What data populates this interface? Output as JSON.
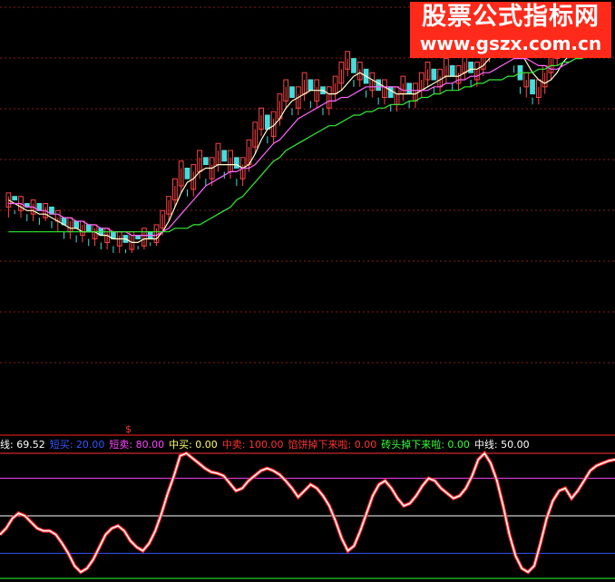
{
  "watermark": {
    "line1": "股票公式指标网",
    "line2": "www.gszx.com.cn"
  },
  "indicator_legend": [
    {
      "label": "线: 69.52",
      "color": "#ffffff"
    },
    {
      "label": "短买: 20.00",
      "color": "#3355ff"
    },
    {
      "label": "短卖: 80.00",
      "color": "#ff44ff"
    },
    {
      "label": "中买: 0.00",
      "color": "#ffff66"
    },
    {
      "label": "中卖: 100.00",
      "color": "#ff3333"
    },
    {
      "label": "馅饼掉下来啦: 0.00",
      "color": "#ff3333"
    },
    {
      "label": "砖头掉下来啦: 0.00",
      "color": "#33ff33"
    },
    {
      "label": "中线: 50.00",
      "color": "#ffffff"
    }
  ],
  "chart_data": [
    {
      "type": "candlestick",
      "panel": "price",
      "title": "",
      "grid": true,
      "ylim": [
        0,
        100
      ],
      "candles": [
        [
          0,
          44,
          48,
          41,
          47
        ],
        [
          1,
          47,
          46,
          42,
          43
        ],
        [
          2,
          43,
          47,
          41,
          45
        ],
        [
          3,
          45,
          44,
          40,
          42
        ],
        [
          4,
          42,
          46,
          40,
          45
        ],
        [
          5,
          45,
          43,
          39,
          41
        ],
        [
          6,
          41,
          45,
          40,
          44
        ],
        [
          7,
          44,
          42,
          38,
          40
        ],
        [
          8,
          40,
          43,
          37,
          41
        ],
        [
          9,
          41,
          39,
          35,
          37
        ],
        [
          10,
          37,
          41,
          35,
          40
        ],
        [
          11,
          40,
          38,
          34,
          36
        ],
        [
          12,
          36,
          40,
          34,
          39
        ],
        [
          13,
          39,
          37,
          33,
          35
        ],
        [
          14,
          35,
          39,
          33,
          38
        ],
        [
          15,
          38,
          36,
          32,
          34
        ],
        [
          16,
          34,
          38,
          32,
          37
        ],
        [
          17,
          37,
          35,
          31,
          33
        ],
        [
          18,
          33,
          37,
          31,
          36
        ],
        [
          19,
          36,
          34,
          31,
          32
        ],
        [
          20,
          32,
          37,
          31,
          36
        ],
        [
          21,
          36,
          35,
          32,
          33
        ],
        [
          22,
          33,
          38,
          32,
          37
        ],
        [
          23,
          37,
          35,
          33,
          34
        ],
        [
          24,
          34,
          39,
          33,
          38
        ],
        [
          25,
          38,
          43,
          36,
          42
        ],
        [
          26,
          42,
          47,
          40,
          46
        ],
        [
          27,
          46,
          52,
          44,
          50
        ],
        [
          28,
          50,
          57,
          48,
          55
        ],
        [
          29,
          55,
          52,
          47,
          49
        ],
        [
          30,
          49,
          56,
          47,
          54
        ],
        [
          31,
          54,
          60,
          52,
          58
        ],
        [
          32,
          58,
          56,
          50,
          52
        ],
        [
          33,
          52,
          58,
          50,
          56
        ],
        [
          34,
          56,
          62,
          54,
          60
        ],
        [
          35,
          60,
          57,
          52,
          54
        ],
        [
          36,
          54,
          60,
          52,
          58
        ],
        [
          37,
          58,
          55,
          50,
          52
        ],
        [
          38,
          52,
          58,
          50,
          56
        ],
        [
          39,
          56,
          63,
          54,
          61
        ],
        [
          40,
          61,
          68,
          59,
          66
        ],
        [
          41,
          66,
          72,
          64,
          70
        ],
        [
          42,
          70,
          66,
          62,
          64
        ],
        [
          43,
          64,
          71,
          62,
          69
        ],
        [
          44,
          69,
          76,
          67,
          74
        ],
        [
          45,
          74,
          80,
          72,
          78
        ],
        [
          46,
          78,
          75,
          70,
          72
        ],
        [
          47,
          72,
          78,
          70,
          76
        ],
        [
          48,
          76,
          82,
          74,
          80
        ],
        [
          49,
          80,
          77,
          72,
          74
        ],
        [
          50,
          74,
          80,
          72,
          78
        ],
        [
          51,
          78,
          76,
          70,
          72
        ],
        [
          52,
          72,
          78,
          70,
          76
        ],
        [
          53,
          76,
          81,
          74,
          79
        ],
        [
          54,
          79,
          85,
          77,
          83
        ],
        [
          55,
          83,
          88,
          81,
          86
        ],
        [
          56,
          86,
          82,
          78,
          80
        ],
        [
          57,
          80,
          85,
          78,
          83
        ],
        [
          58,
          83,
          79,
          75,
          77
        ],
        [
          59,
          77,
          82,
          75,
          80
        ],
        [
          60,
          80,
          77,
          73,
          75
        ],
        [
          61,
          75,
          80,
          73,
          78
        ],
        [
          62,
          78,
          75,
          71,
          73
        ],
        [
          63,
          73,
          78,
          71,
          76
        ],
        [
          64,
          76,
          81,
          74,
          79
        ],
        [
          65,
          79,
          76,
          72,
          74
        ],
        [
          66,
          74,
          79,
          72,
          77
        ],
        [
          67,
          77,
          82,
          75,
          80
        ],
        [
          68,
          80,
          85,
          78,
          83
        ],
        [
          69,
          83,
          80,
          76,
          78
        ],
        [
          70,
          78,
          83,
          76,
          81
        ],
        [
          71,
          81,
          86,
          79,
          84
        ],
        [
          72,
          84,
          81,
          77,
          79
        ],
        [
          73,
          79,
          84,
          77,
          82
        ],
        [
          74,
          82,
          87,
          80,
          85
        ],
        [
          75,
          85,
          82,
          78,
          80
        ],
        [
          76,
          80,
          85,
          78,
          83
        ],
        [
          77,
          83,
          89,
          81,
          87
        ],
        [
          78,
          87,
          93,
          85,
          91
        ],
        [
          79,
          91,
          97,
          89,
          95
        ],
        [
          80,
          95,
          91,
          86,
          88
        ],
        [
          81,
          88,
          93,
          86,
          91
        ],
        [
          82,
          91,
          87,
          82,
          84
        ],
        [
          83,
          84,
          80,
          76,
          78
        ],
        [
          84,
          78,
          82,
          75,
          80
        ],
        [
          85,
          80,
          76,
          73,
          75
        ],
        [
          86,
          75,
          80,
          73,
          78
        ],
        [
          87,
          78,
          84,
          76,
          82
        ],
        [
          88,
          82,
          88,
          80,
          86
        ],
        [
          89,
          86,
          92,
          84,
          90
        ],
        [
          90,
          90,
          95,
          88,
          93
        ],
        [
          91,
          93,
          90,
          86,
          88
        ],
        [
          92,
          88,
          93,
          86,
          91
        ],
        [
          93,
          91,
          96,
          89,
          94
        ],
        [
          94,
          94,
          98,
          92,
          96
        ],
        [
          95,
          96,
          93,
          89,
          91
        ],
        [
          96,
          91,
          96,
          89,
          94
        ],
        [
          97,
          94,
          98,
          92,
          97
        ]
      ],
      "series": [
        {
          "color": "#ffffcc",
          "values": [
            46,
            45,
            44,
            43,
            43,
            42,
            42,
            41,
            40,
            39,
            38,
            38,
            37,
            37,
            37,
            36,
            36,
            35,
            35,
            35,
            34,
            34,
            35,
            35,
            35,
            37,
            40,
            44,
            48,
            51,
            52,
            54,
            55,
            55,
            56,
            56,
            56,
            56,
            55,
            56,
            59,
            63,
            66,
            67,
            69,
            72,
            74,
            75,
            76,
            77,
            77,
            77,
            76,
            76,
            77,
            79,
            81,
            82,
            81,
            80,
            79,
            78,
            77,
            76,
            76,
            76,
            76,
            77,
            78,
            79,
            80,
            81,
            81,
            81,
            82,
            83,
            83,
            84,
            86,
            89,
            91,
            91,
            90,
            88,
            85,
            82,
            80,
            79,
            80,
            82,
            85,
            87,
            89,
            90,
            92,
            93,
            94,
            95
          ]
        },
        {
          "color": "#ff66ff",
          "values": [
            45,
            45,
            45,
            44,
            44,
            43,
            43,
            42,
            42,
            41,
            41,
            40,
            40,
            39,
            39,
            38,
            38,
            37,
            37,
            37,
            36,
            36,
            36,
            36,
            36,
            37,
            38,
            40,
            42,
            44,
            46,
            48,
            50,
            51,
            52,
            53,
            54,
            54,
            55,
            55,
            56,
            58,
            60,
            62,
            63,
            65,
            67,
            69,
            70,
            71,
            72,
            73,
            74,
            74,
            75,
            75,
            76,
            77,
            78,
            78,
            78,
            78,
            78,
            78,
            77,
            77,
            77,
            77,
            77,
            78,
            78,
            79,
            79,
            80,
            80,
            81,
            81,
            82,
            82,
            83,
            84,
            85,
            86,
            86,
            86,
            85,
            84,
            84,
            83,
            83,
            84,
            85,
            86,
            87,
            88,
            89,
            90,
            91
          ]
        },
        {
          "color": "#33ee33",
          "values": [
            37,
            37,
            37,
            37,
            37,
            37,
            37,
            37,
            37,
            37,
            37,
            37,
            37,
            37,
            37,
            37,
            37,
            37,
            37,
            37,
            37,
            37,
            37,
            37,
            37,
            37,
            37,
            38,
            38,
            38,
            39,
            39,
            40,
            41,
            42,
            43,
            44,
            46,
            47,
            49,
            51,
            53,
            55,
            57,
            58,
            60,
            61,
            62,
            63,
            64,
            65,
            66,
            67,
            67,
            68,
            69,
            70,
            70,
            71,
            71,
            72,
            72,
            73,
            73,
            73,
            74,
            74,
            75,
            75,
            76,
            76,
            77,
            77,
            77,
            78,
            78,
            79,
            79,
            80,
            80,
            80,
            81,
            81,
            82,
            82,
            82,
            83,
            83,
            84,
            84,
            85,
            85,
            86,
            86,
            87,
            87,
            88,
            88
          ]
        }
      ]
    },
    {
      "type": "line",
      "panel": "indicator",
      "title": "",
      "ylim": [
        0,
        100
      ],
      "grid": false,
      "hlines": [
        {
          "name": "中卖",
          "value": 100,
          "color": "#ff3333"
        },
        {
          "name": "短卖",
          "value": 80,
          "color": "#ff44ff"
        },
        {
          "name": "中线",
          "value": 50,
          "color": "#ffffff"
        },
        {
          "name": "短买",
          "value": 20,
          "color": "#3355ff"
        },
        {
          "name": "中买",
          "value": 0,
          "color": "#33ff33"
        }
      ],
      "series": [
        {
          "name": "线",
          "color": "#ffffff",
          "values": [
            35,
            40,
            48,
            52,
            50,
            45,
            40,
            38,
            38,
            35,
            28,
            20,
            10,
            5,
            8,
            15,
            25,
            35,
            40,
            42,
            38,
            30,
            25,
            22,
            28,
            38,
            52,
            68,
            82,
            98,
            100,
            96,
            92,
            88,
            85,
            84,
            82,
            76,
            70,
            72,
            78,
            82,
            86,
            88,
            86,
            83,
            78,
            72,
            65,
            70,
            75,
            72,
            66,
            58,
            46,
            32,
            22,
            26,
            38,
            52,
            66,
            75,
            78,
            72,
            64,
            58,
            60,
            66,
            74,
            80,
            78,
            72,
            68,
            64,
            66,
            72,
            82,
            95,
            100,
            92,
            78,
            58,
            35,
            18,
            8,
            5,
            10,
            28,
            48,
            62,
            70,
            72,
            64,
            70,
            78,
            86,
            90,
            92,
            94,
            95
          ]
        }
      ]
    }
  ]
}
